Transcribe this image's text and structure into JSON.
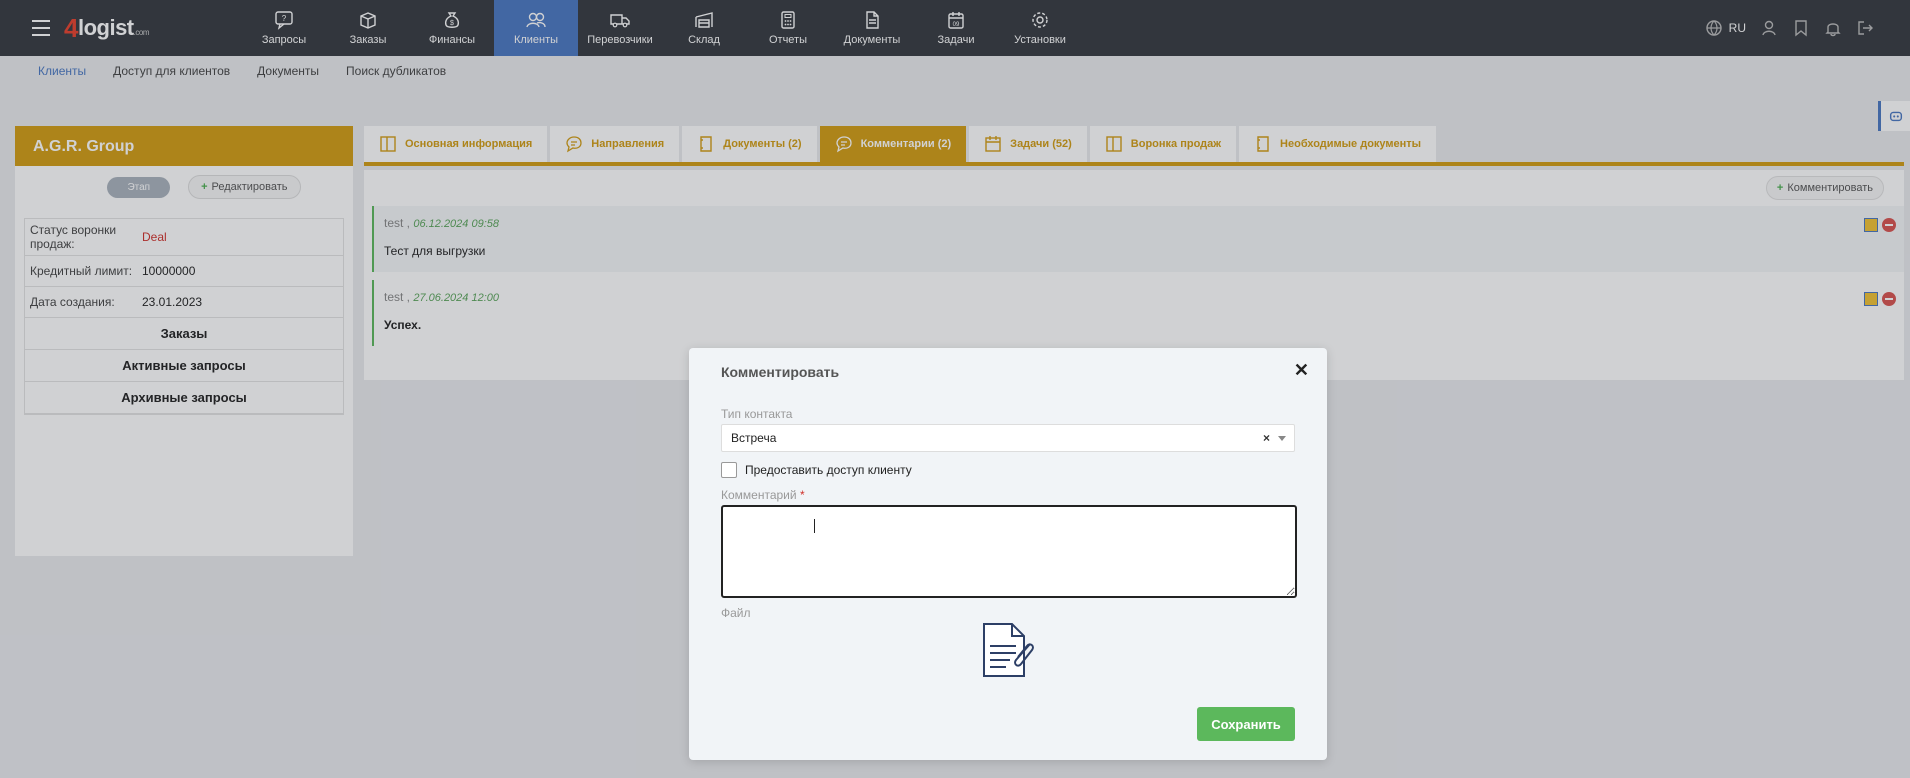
{
  "app": {
    "logo_main": "logist",
    "logo_digit": "4",
    "logo_suffix": ".com"
  },
  "nav": {
    "items": [
      {
        "label": "Запросы",
        "icon": "question-chat-icon"
      },
      {
        "label": "Заказы",
        "icon": "box-icon"
      },
      {
        "label": "Финансы",
        "icon": "money-bag-icon"
      },
      {
        "label": "Клиенты",
        "icon": "users-icon",
        "active": true
      },
      {
        "label": "Перевозчики",
        "icon": "truck-icon"
      },
      {
        "label": "Склад",
        "icon": "warehouse-icon"
      },
      {
        "label": "Отчеты",
        "icon": "calculator-icon"
      },
      {
        "label": "Документы",
        "icon": "document-icon"
      },
      {
        "label": "Задачи",
        "icon": "calendar-icon"
      },
      {
        "label": "Установки",
        "icon": "gear-icon"
      }
    ],
    "lang": "RU"
  },
  "subnav": {
    "items": [
      "Клиенты",
      "Доступ для клиентов",
      "Документы",
      "Поиск дубликатов"
    ]
  },
  "client": {
    "name": "A.G.R. Group",
    "stage_label": "Этап",
    "edit_label": "Редактировать",
    "info": [
      {
        "label": "Статус воронки продаж:",
        "value": "Deal"
      },
      {
        "label": "Кредитный лимит:",
        "value": "10000000"
      },
      {
        "label": "Дата создания:",
        "value": "23.01.2023"
      }
    ],
    "links": [
      "Заказы",
      "Активные запросы",
      "Архивные запросы"
    ]
  },
  "tabs": [
    {
      "label": "Основная информация"
    },
    {
      "label": "Направления"
    },
    {
      "label": "Документы  (2)"
    },
    {
      "label": "Комментарии  (2)",
      "active": true
    },
    {
      "label": "Задачи  (52)"
    },
    {
      "label": "Воронка продаж"
    },
    {
      "label": "Необходимые документы"
    }
  ],
  "comments_panel": {
    "add_label": "Комментировать",
    "items": [
      {
        "author": "test",
        "date": "06.12.2024 09:58",
        "text": "Тест для выгрузки"
      },
      {
        "author": "test",
        "date": "27.06.2024 12:00",
        "text": "Успех."
      }
    ]
  },
  "modal": {
    "title": "Комментировать",
    "contact_type_label": "Тип контакта",
    "contact_type_value": "Встреча",
    "share_label": "Предоставить доступ клиенту",
    "comment_label": "Комментарий",
    "required_mark": "*",
    "comment_value": "",
    "file_label": "Файл",
    "save_label": "Сохранить"
  },
  "colors": {
    "accent": "#d39d12",
    "nav_bg": "#35393f",
    "nav_active": "#4a78c2",
    "save": "#5cb85c"
  }
}
